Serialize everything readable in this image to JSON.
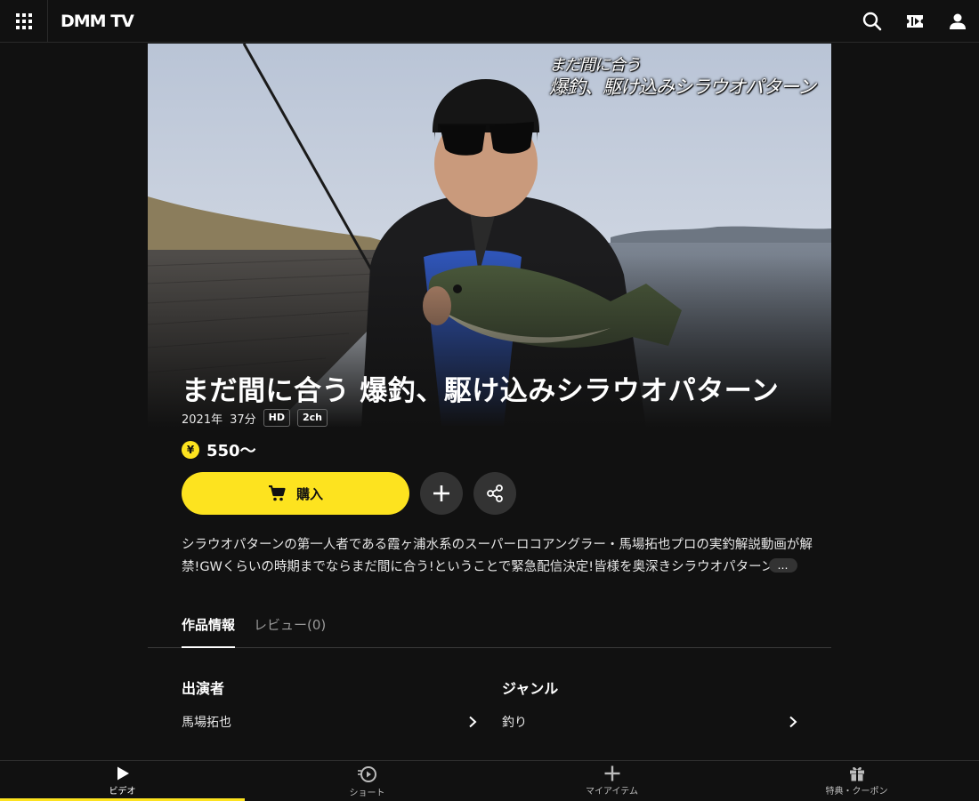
{
  "header": {
    "logo": "DMM TV",
    "icons": [
      "grid-menu-icon",
      "search-icon",
      "ticket-icon",
      "user-icon"
    ]
  },
  "hero": {
    "caption_line1": "まだ間に合う",
    "caption_line2": "爆釣、駆け込みシラウオパターン"
  },
  "title": "まだ間に合う 爆釣、駆け込みシラウオパターン",
  "meta": {
    "year": "2021年",
    "duration": "37分",
    "badges": [
      "HD",
      "2ch"
    ]
  },
  "price": {
    "yen_symbol": "¥",
    "text": "550〜"
  },
  "actions": {
    "buy_label": "購入",
    "icons": [
      "cart-icon",
      "plus-icon",
      "share-icon"
    ]
  },
  "description": {
    "text": "シラウオパターンの第一人者である霞ヶ浦水系のスーパーロコアングラー・馬場拓也プロの実釣解説動画が解禁!GWくらいの時期までならまだ間に合う!ということで緊急配信決定!皆様を奥深きシラウオパターンの",
    "more": "…"
  },
  "tabs": [
    {
      "label": "作品情報",
      "active": true
    },
    {
      "label": "レビュー(0)",
      "active": false
    }
  ],
  "info": {
    "cast_heading": "出演者",
    "cast_value": "馬場拓也",
    "genre_heading": "ジャンル",
    "genre_value": "釣り"
  },
  "bottom_nav": [
    {
      "label": "ビデオ",
      "icon": "play-icon",
      "active": true
    },
    {
      "label": "ショート",
      "icon": "short-play-icon",
      "active": false
    },
    {
      "label": "マイアイテム",
      "icon": "plus-icon",
      "active": false
    },
    {
      "label": "特典・クーポン",
      "icon": "gift-icon",
      "active": false
    }
  ],
  "colors": {
    "accent": "#fde31f",
    "background": "#111111",
    "button_dark": "#333333"
  }
}
